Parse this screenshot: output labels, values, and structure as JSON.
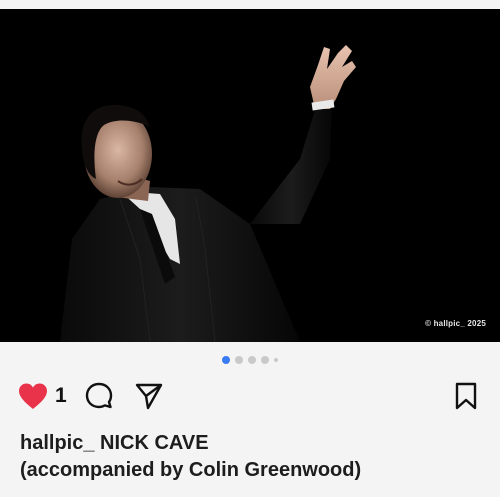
{
  "post": {
    "watermark": "© hallpic_ 2025",
    "carousel": {
      "count": 5,
      "active_index": 0
    },
    "likes": {
      "liked": true,
      "count": "1"
    },
    "icons": {
      "like": "heart-icon",
      "comment": "comment-bubble-icon",
      "share": "paper-plane-icon",
      "save": "bookmark-icon"
    },
    "caption": {
      "username": "hallpic_",
      "text_line1": "NICK CAVE",
      "text_line2": "(accompanied by Colin Greenwood)"
    },
    "colors": {
      "like": "#e8334a",
      "carousel_active": "#3a7bf5",
      "background": "#f4f4f4"
    }
  }
}
